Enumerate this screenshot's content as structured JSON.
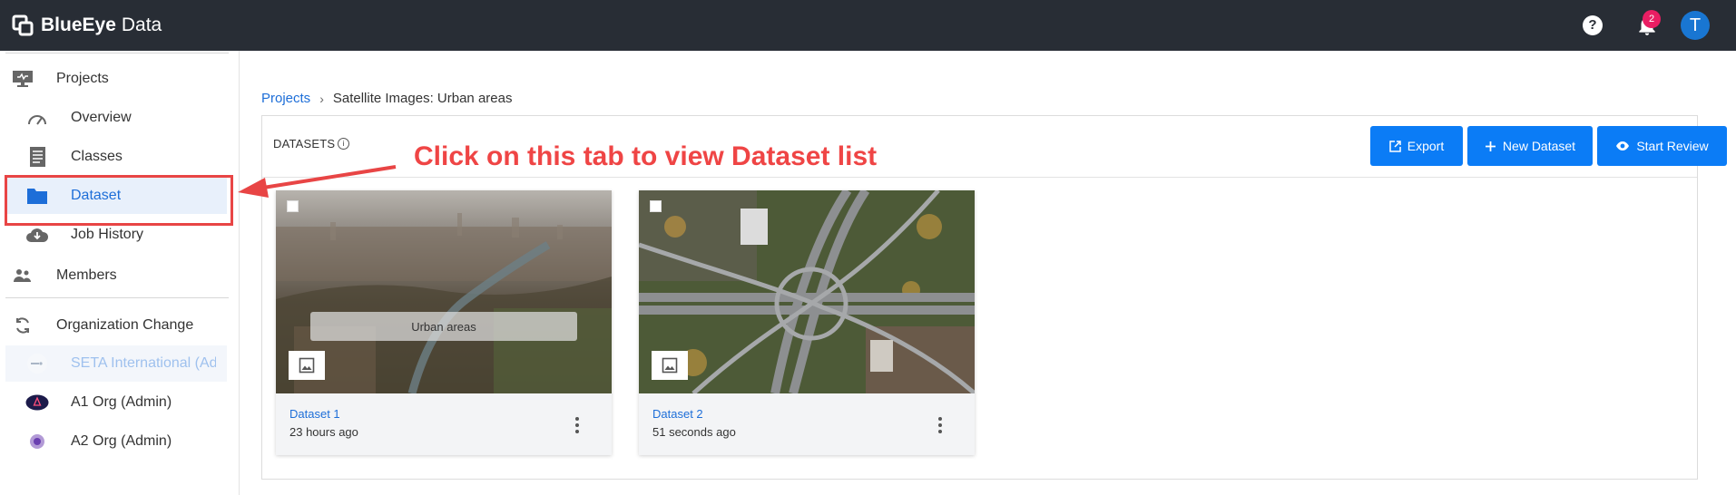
{
  "app": {
    "brand_bold": "BlueEye",
    "brand_light": "Data",
    "notification_count": "2",
    "avatar_initial": "T",
    "help_label": "?"
  },
  "sidebar": {
    "items": [
      {
        "label": "Projects"
      },
      {
        "label": "Overview"
      },
      {
        "label": "Classes"
      },
      {
        "label": "Dataset"
      },
      {
        "label": "Job History"
      },
      {
        "label": "Members"
      },
      {
        "label": "Organization Change"
      },
      {
        "label": "SETA International (Admin)"
      },
      {
        "label": "A1 Org (Admin)"
      },
      {
        "label": "A2 Org (Admin)"
      }
    ]
  },
  "breadcrumb": {
    "root": "Projects",
    "current": "Satellite Images: Urban areas"
  },
  "panel": {
    "title": "DATASETS",
    "buttons": {
      "export": "Export",
      "new_dataset": "New Dataset",
      "start_review": "Start Review"
    }
  },
  "datasets": [
    {
      "name": "Dataset 1",
      "time": "23 hours ago",
      "tag": "Urban areas"
    },
    {
      "name": "Dataset 2",
      "time": "51 seconds ago"
    }
  ],
  "annotation": {
    "text": "Click on this tab to view Dataset list"
  },
  "colors": {
    "accent": "#0b7cf6",
    "topbar": "#282d35",
    "annotation": "#ef4545",
    "badge": "#e91e63"
  }
}
